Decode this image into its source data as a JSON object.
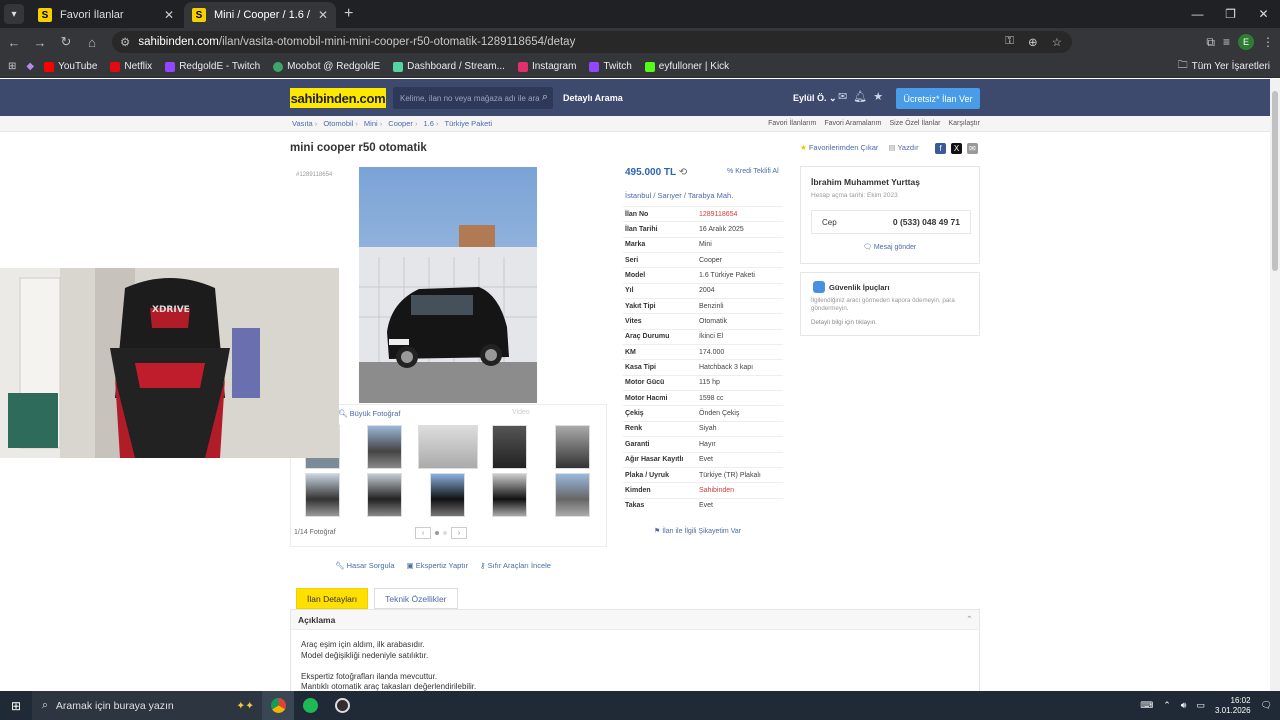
{
  "browser": {
    "tabs": [
      {
        "title": "Favori İlanlar",
        "active": false
      },
      {
        "title": "Mini / Cooper / 1.6 / Türkiye Pa",
        "active": true
      }
    ],
    "url_prefix": "sahibinden.com",
    "url_rest": "/ilan/vasita-otomobil-mini-mini-cooper-r50-otomatik-1289118654/detay",
    "bookmarks": [
      "YouTube",
      "Netflix",
      "RedgoldE - Twitch",
      "Moobot @ RedgoldE",
      "Dashboard / Stream...",
      "Instagram",
      "Twitch",
      "eyfulloner | Kick"
    ],
    "bookmarks_right": "Tüm Yer İşaretleri",
    "bookmark_colors": [
      "#ff0000",
      "#e50914",
      "#9146ff",
      "#3fa66a",
      "#53fc18",
      "#e1306c",
      "#9146ff",
      "#53fc18"
    ]
  },
  "header": {
    "logo": "sahibinden.com",
    "search_placeholder": "Kelime, ilan no veya mağaza adı ile ara",
    "detailed_search": "Detaylı Arama",
    "user": "Eylül Ö.",
    "post_button": "Ücretsiz* İlan Ver"
  },
  "breadcrumbs": [
    "Vasıta",
    "Otomobil",
    "Mini",
    "Cooper",
    "1.6",
    "Türkiye Paketi"
  ],
  "top_links": [
    "Favori İlanlarım",
    "Favori Aramalarım",
    "Size Özel İlanlar",
    "Karşılaştır"
  ],
  "listing": {
    "title": "mini cooper r50 otomatik",
    "fav_action": "Favorilerimden Çıkar",
    "print": "Yazdır",
    "ad_id_small": "#1289118654",
    "big_photo_link": "Büyük Fotoğraf",
    "video_link": "Video",
    "photo_count": "1/14 Fotoğraf",
    "price": "495.000 TL",
    "credit": "Kredi Teklifi Al",
    "location": [
      "İstanbul",
      "Sarıyer",
      "Tarabya Mah."
    ],
    "specs": [
      {
        "k": "İlan No",
        "v": "1289118654",
        "red": true
      },
      {
        "k": "İlan Tarihi",
        "v": "16 Aralık 2025"
      },
      {
        "k": "Marka",
        "v": "Mini"
      },
      {
        "k": "Seri",
        "v": "Cooper"
      },
      {
        "k": "Model",
        "v": "1.6 Türkiye Paketi"
      },
      {
        "k": "Yıl",
        "v": "2004"
      },
      {
        "k": "Yakıt Tipi",
        "v": "Benzinli"
      },
      {
        "k": "Vites",
        "v": "Otomatik"
      },
      {
        "k": "Araç Durumu",
        "v": "İkinci El"
      },
      {
        "k": "KM",
        "v": "174.000"
      },
      {
        "k": "Kasa Tipi",
        "v": "Hatchback 3 kapı"
      },
      {
        "k": "Motor Gücü",
        "v": "115 hp"
      },
      {
        "k": "Motor Hacmi",
        "v": "1598 cc"
      },
      {
        "k": "Çekiş",
        "v": "Önden Çekiş"
      },
      {
        "k": "Renk",
        "v": "Siyah"
      },
      {
        "k": "Garanti",
        "v": "Hayır"
      },
      {
        "k": "Ağır Hasar Kayıtlı",
        "v": "Evet"
      },
      {
        "k": "Plaka / Uyruk",
        "v": "Türkiye (TR) Plakalı"
      },
      {
        "k": "Kimden",
        "v": "Sahibinden",
        "red": true
      },
      {
        "k": "Takas",
        "v": "Evet"
      }
    ],
    "complaint": "İlan ile İlgili Şikayetim Var",
    "action_links": [
      "Hasar Sorgula",
      "Ekspertiz Yaptır",
      "Sıfır Araçları İncele"
    ],
    "tabs": [
      "İlan Detayları",
      "Teknik Özellikler"
    ],
    "description_title": "Açıklama",
    "description_lines": [
      "Araç eşim için aldım, ilk arabasıdır.",
      "Model değişikliği nedeniyle satılıktır.",
      "",
      "Ekspertiz fotoğrafları ilanda mevcuttur.",
      "Mantıklı otomatik araç takasları değerlendirilebilir."
    ]
  },
  "seller": {
    "name": "İbrahim Muhammet Yurttaş",
    "since": "Hesap açma tarihi: Ekim 2023",
    "phone_label": "Cep",
    "phone": "0 (533) 048 49 71",
    "message": "Mesaj gönder"
  },
  "safety": {
    "title": "Güvenlik İpuçları",
    "text": "İlgilendiğiniz aracı görmeden kapora ödemeyin, para göndermeyin.",
    "more": "Detaylı bilgi için tıklayın."
  },
  "taskbar": {
    "search": "Aramak için buraya yazın",
    "time": "16:02",
    "date": "3.01.2026"
  }
}
